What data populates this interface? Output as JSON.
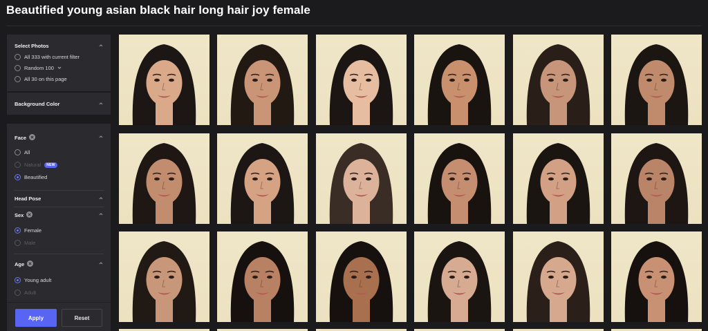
{
  "page": {
    "title": "Beautified young asian black hair long hair joy female"
  },
  "sidebar": {
    "select_photos": {
      "label": "Select Photos",
      "options": [
        "All 333 with current filter",
        "Random 100",
        "All 30 on this page"
      ]
    },
    "background_color": {
      "label": "Background Color"
    },
    "face": {
      "label": "Face",
      "options": [
        "All",
        "Natural",
        "Beautified"
      ],
      "new_badge": "NEW",
      "selected": "Beautified"
    },
    "head_pose": {
      "label": "Head Pose"
    },
    "sex": {
      "label": "Sex",
      "options": [
        "Female",
        "Male"
      ],
      "selected": "Female"
    },
    "age": {
      "label": "Age",
      "options": [
        "Young adult",
        "Adult"
      ],
      "selected": "Young adult"
    },
    "apply_label": "Apply",
    "reset_label": "Reset"
  },
  "colors": {
    "background": "#1b1b1d",
    "panel": "#2b2b2f",
    "accent": "#5865f2",
    "photo_background": "#efe6c8"
  },
  "photos": [
    {
      "skin": "#d9a98a",
      "hair": "#1c1714"
    },
    {
      "skin": "#c99576",
      "hair": "#221913"
    },
    {
      "skin": "#e6bda1",
      "hair": "#1b1614"
    },
    {
      "skin": "#c9906e",
      "hair": "#1a1411"
    },
    {
      "skin": "#c7967a",
      "hair": "#2a1f18"
    },
    {
      "skin": "#c08a6c",
      "hair": "#1c1613"
    },
    {
      "skin": "#c28c6e",
      "hair": "#1e1713"
    },
    {
      "skin": "#d5a284",
      "hair": "#1c1714"
    },
    {
      "skin": "#dcb29b",
      "hair": "#3a2d25"
    },
    {
      "skin": "#c68e70",
      "hair": "#19130f"
    },
    {
      "skin": "#d2a085",
      "hair": "#1b1512"
    },
    {
      "skin": "#b98468",
      "hair": "#1d1612"
    },
    {
      "skin": "#c8977a",
      "hair": "#211914"
    },
    {
      "skin": "#b98163",
      "hair": "#16110e"
    },
    {
      "skin": "#a8704f",
      "hair": "#16110e"
    },
    {
      "skin": "#d7ab92",
      "hair": "#1b1512"
    },
    {
      "skin": "#d6a98f",
      "hair": "#2b2019"
    },
    {
      "skin": "#c99173",
      "hair": "#16110e"
    }
  ]
}
